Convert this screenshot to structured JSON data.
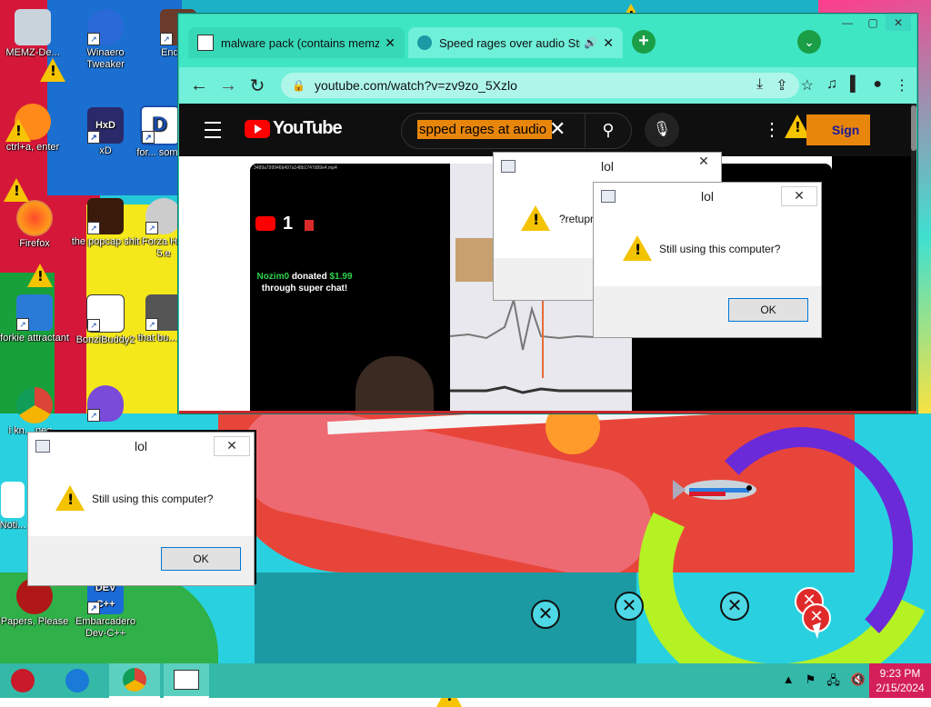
{
  "desktop": {
    "icons": [
      {
        "name": "desktop-icon-memz",
        "label": "MEMZ-De..."
      },
      {
        "name": "desktop-icon-winaero",
        "label": "Winaero Tweaker"
      },
      {
        "name": "desktop-icon-ender",
        "label": "Ender..."
      },
      {
        "name": "desktop-icon-ctrl",
        "label": "ctrl+a, enter"
      },
      {
        "name": "desktop-icon-xd",
        "label": "xD"
      },
      {
        "name": "desktop-icon-for",
        "label": "for... some"
      },
      {
        "name": "desktop-icon-firefox",
        "label": "Firefox"
      },
      {
        "name": "desktop-icon-popcap",
        "label": "the popcap shit"
      },
      {
        "name": "desktop-icon-forza",
        "label": "Forza H... 5.e"
      },
      {
        "name": "desktop-icon-forkie",
        "label": "forkie attractant"
      },
      {
        "name": "desktop-icon-bonzi",
        "label": "BonziBuddy2"
      },
      {
        "name": "desktop-icon-thatbu",
        "label": "that bu... its"
      },
      {
        "name": "desktop-icon-chrome",
        "label": "i kn... peo..."
      },
      {
        "name": "desktop-icon-noti",
        "label": "Noti..."
      },
      {
        "name": "desktop-icon-papers",
        "label": "Papers, Please"
      },
      {
        "name": "desktop-icon-devcpp",
        "label": "Embarcadero Dev-C++"
      }
    ]
  },
  "browser": {
    "tabs": [
      {
        "label": "malware pack (contains memz) :",
        "close": "✕"
      },
      {
        "label": "Speed rages over audio Stre",
        "close": "✕"
      }
    ],
    "new_tab": "+",
    "url": "youtube.com/watch?v=zv9zo_5Xzlo",
    "window_controls": {
      "min": "—",
      "max": "▢",
      "close": "✕"
    }
  },
  "youtube": {
    "logo_text": "YouTube",
    "search_query": "spped rages at audio",
    "sign_in": "Sign in",
    "video": {
      "file_label": "3489a799946b497a148b1747d99e4.mp4",
      "count": "1",
      "donor": "Nozim0",
      "donated_text": "donated",
      "amount": "$1.99",
      "superchat_text": "through super chat!"
    }
  },
  "dialogs": [
    {
      "name": "dialog-lol-back",
      "title": "lol",
      "message": "?retupr",
      "close": "✕"
    },
    {
      "name": "dialog-lol-front",
      "title": "lol",
      "message": "Still using this computer?",
      "ok": "OK",
      "close": "✕"
    },
    {
      "name": "dialog-lol-bottom",
      "title": "lol",
      "message": "Still using this computer?",
      "ok": "OK",
      "close": "✕"
    }
  ],
  "taskbar": {
    "time": "9:23 PM",
    "date": "2/15/2024"
  },
  "colors": {
    "chrome_frame": "#3fe6c4",
    "youtube_bg": "#0f0f0f",
    "search_highlight": "#e8860c",
    "clock_bg": "#d41f5a",
    "taskbar_bg": "#34b8a8"
  }
}
